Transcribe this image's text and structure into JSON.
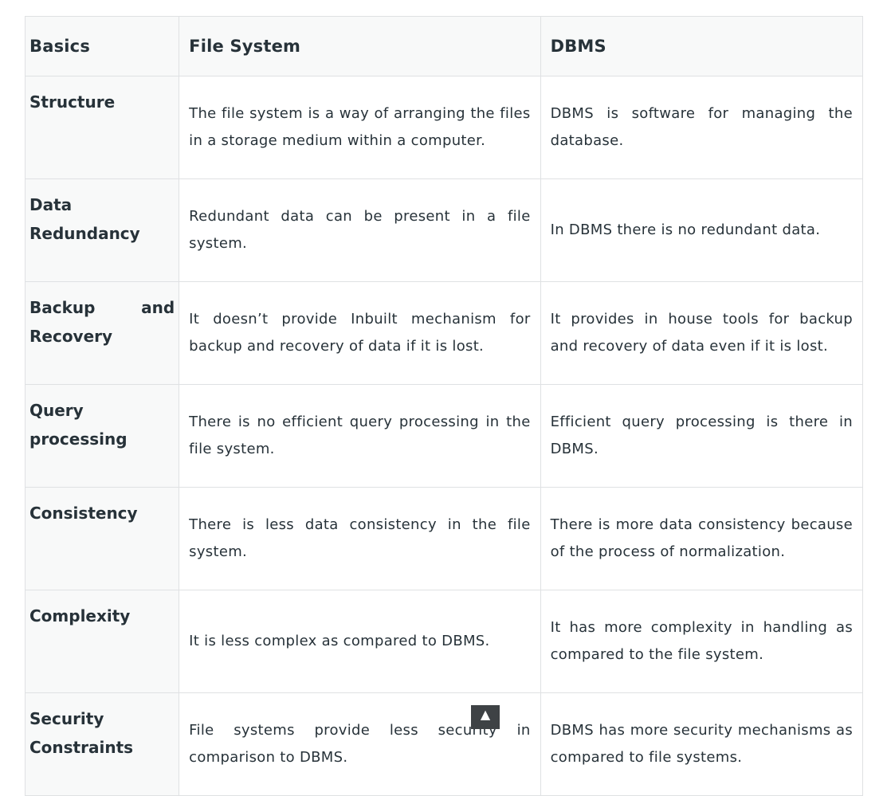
{
  "table": {
    "headers": [
      "Basics",
      "File System",
      "DBMS"
    ],
    "rows": [
      {
        "basics": "Structure",
        "file_system": "The file system is a way of arranging the files in a storage medium within a computer.",
        "dbms": "DBMS is software for managing the database."
      },
      {
        "basics": "Data Redundancy",
        "file_system": "Redundant data can be present in a file system.",
        "dbms": "In DBMS there is no redundant data."
      },
      {
        "basics": "Backup and Recovery",
        "file_system": "It doesn’t provide Inbuilt mechanism for backup and recovery of data if it is lost.",
        "dbms": "It provides in house tools for backup and recovery of data even if it is lost."
      },
      {
        "basics": "Query processing",
        "file_system": "There is no efficient query processing in the file system.",
        "dbms": "Efficient query processing is there in DBMS."
      },
      {
        "basics": "Consistency",
        "file_system": "There is less data consistency in the file system.",
        "dbms": "There is more data consistency because of the process of normalization."
      },
      {
        "basics": "Complexity",
        "file_system": "It is less complex as compared to DBMS.",
        "dbms": "It has more complexity in handling as compared to the file system."
      },
      {
        "basics": "Security Constraints",
        "file_system": "File systems provide less security in comparison to DBMS.",
        "dbms": "DBMS has more security mechanisms as compared to file systems."
      }
    ]
  },
  "scroll_top": {
    "icon": "chevron-up-icon",
    "glyph": "▲"
  }
}
